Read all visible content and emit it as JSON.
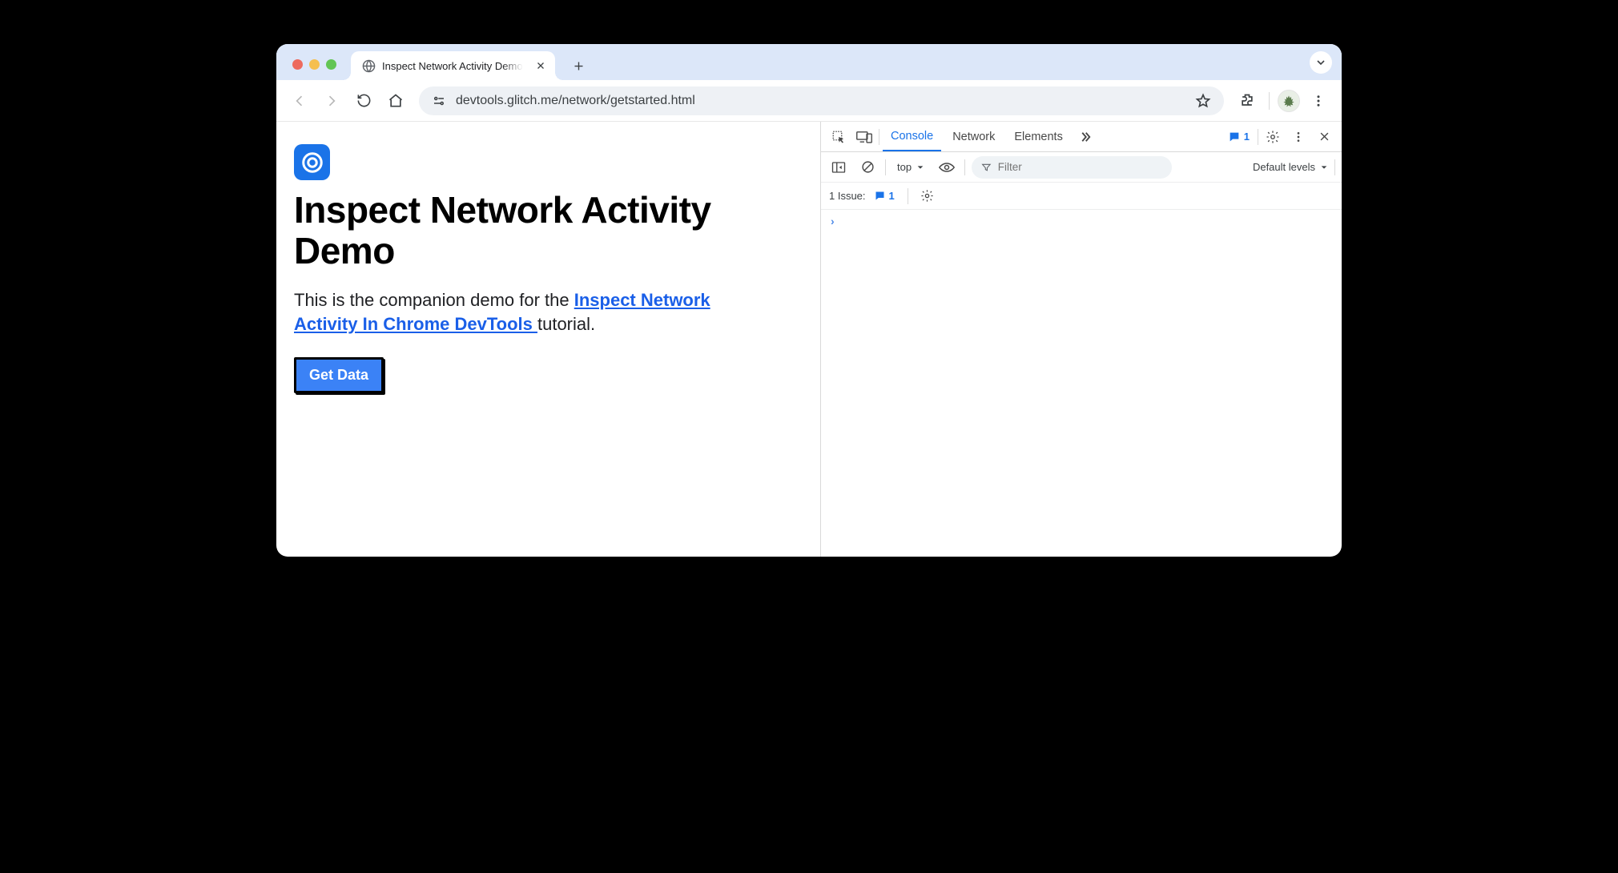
{
  "tabstrip": {
    "active_tab_title": "Inspect Network Activity Demo"
  },
  "toolbar": {
    "url": "devtools.glitch.me/network/getstarted.html"
  },
  "page": {
    "heading": "Inspect Network Activity Demo",
    "paragraph_before_link": "This is the companion demo for the ",
    "link_text": "Inspect Network Activity In Chrome DevTools ",
    "paragraph_after_link": "tutorial.",
    "button_label": "Get Data"
  },
  "devtools": {
    "tabs": {
      "console": "Console",
      "network": "Network",
      "elements": "Elements"
    },
    "issues_badge": "1",
    "subbar": {
      "context": "top",
      "filter_placeholder": "Filter",
      "levels_label": "Default levels"
    },
    "issues_row": {
      "label": "1 Issue:",
      "count": "1"
    },
    "prompt": "›"
  }
}
